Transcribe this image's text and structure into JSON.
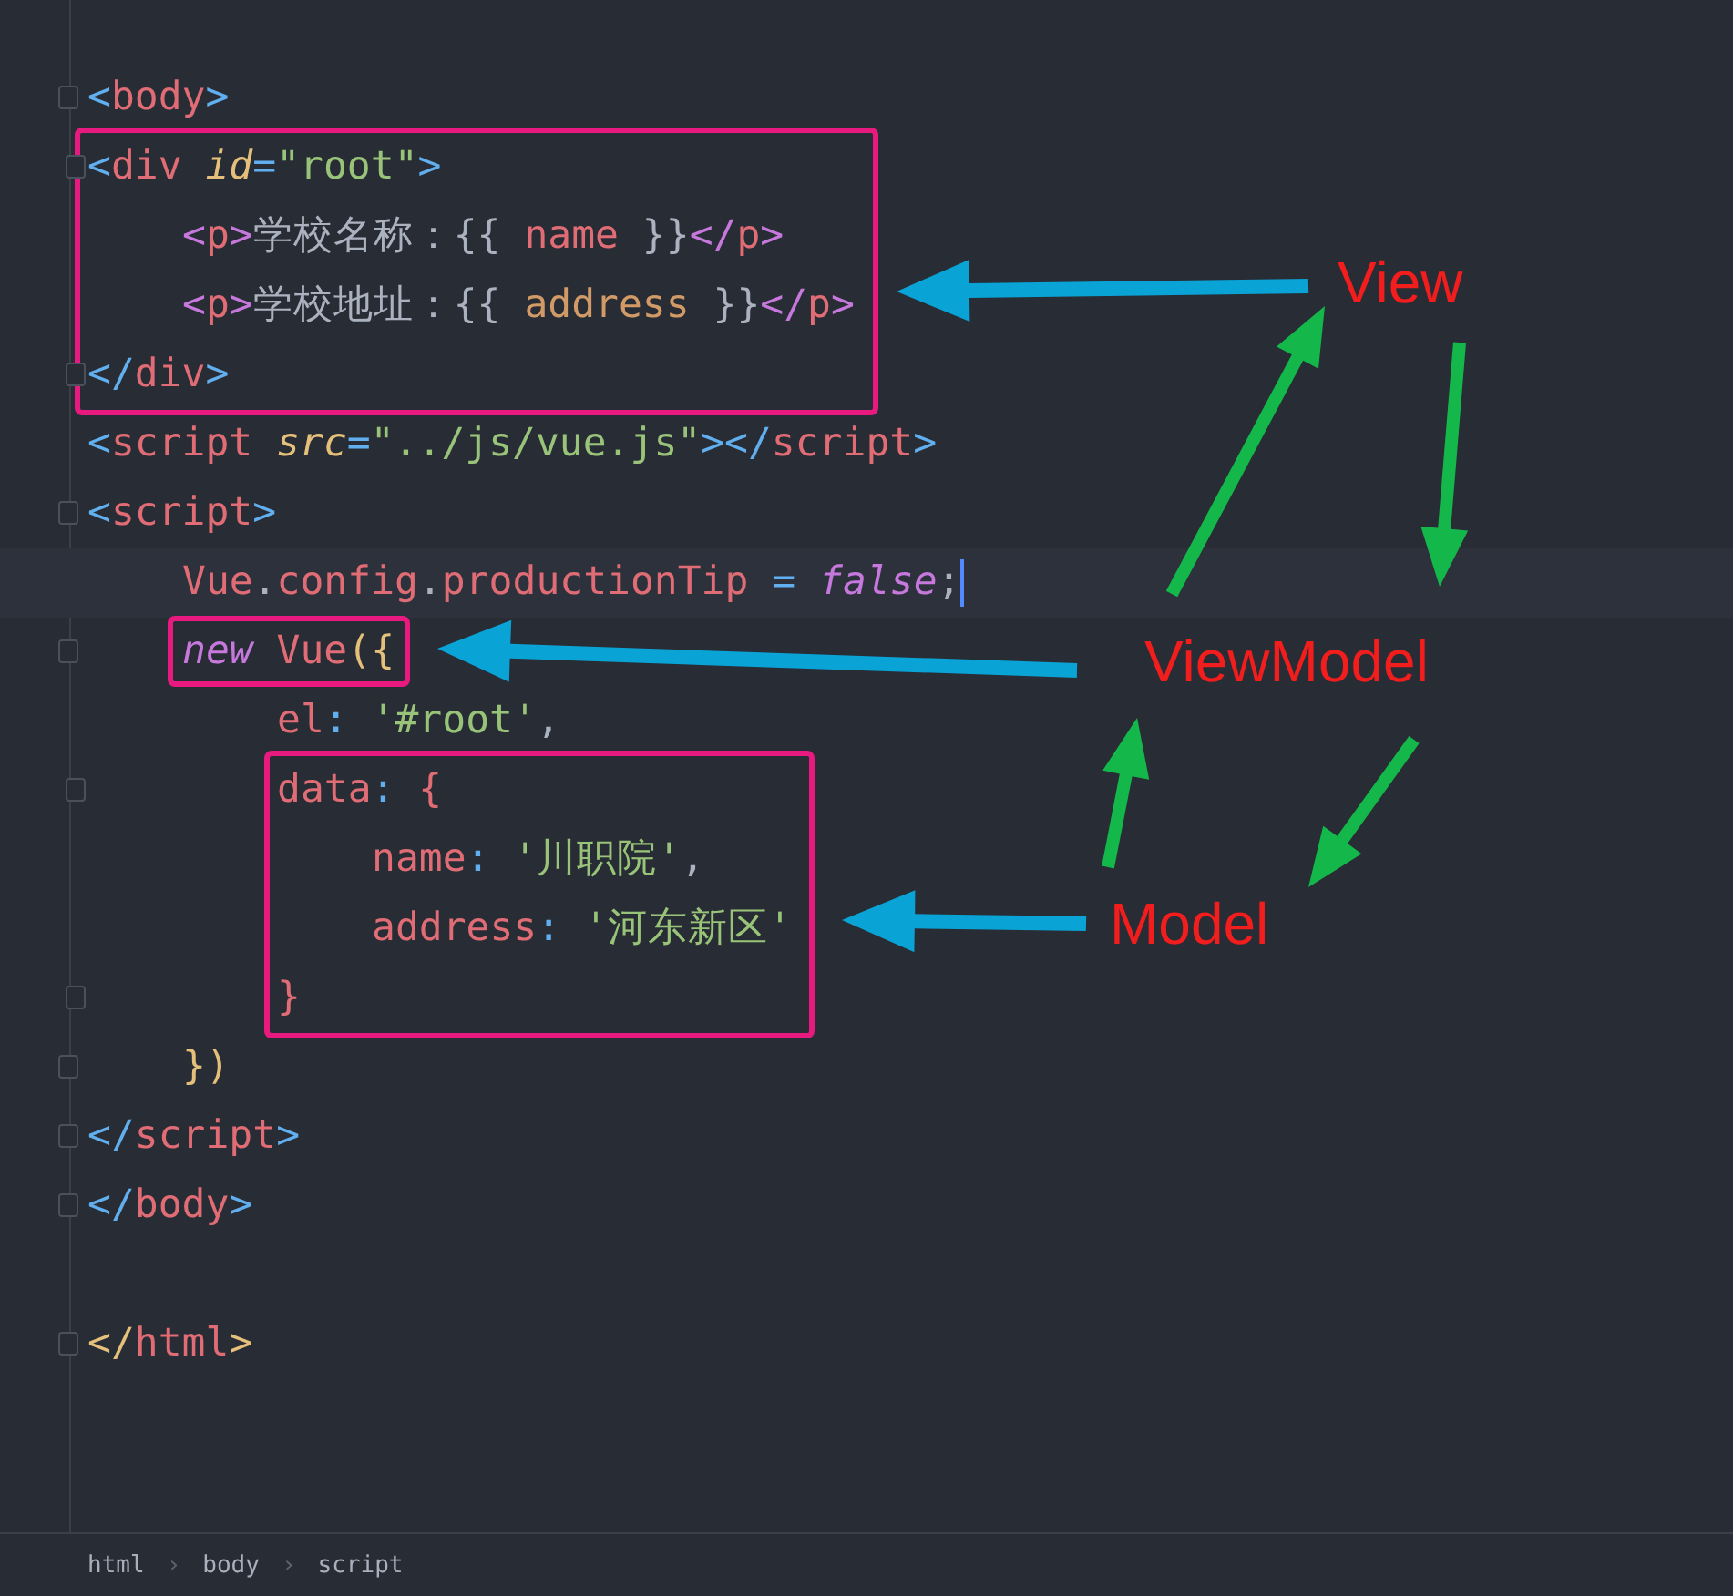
{
  "code": [
    {
      "fold": true,
      "tokens": [
        {
          "kind": "punct",
          "text": "<"
        },
        {
          "kind": "tag",
          "text": "body"
        },
        {
          "kind": "punct",
          "text": ">"
        }
      ]
    },
    {
      "fold": true,
      "framed": true,
      "tokens": [
        {
          "kind": "punct",
          "text": "<"
        },
        {
          "kind": "tag",
          "text": "div"
        },
        {
          "kind": "attr",
          "text": " id"
        },
        {
          "kind": "op",
          "text": "="
        },
        {
          "kind": "str",
          "text": "\"root\""
        },
        {
          "kind": "punct",
          "text": ">"
        }
      ],
      "children": [
        {
          "tokens": [
            {
              "kind": "ptag",
              "text": "<"
            },
            {
              "kind": "tag",
              "text": "p"
            },
            {
              "kind": "ptag",
              "text": ">"
            },
            {
              "kind": "text",
              "text": "学校名称：{{ "
            },
            {
              "kind": "ident",
              "text": "name"
            },
            {
              "kind": "text",
              "text": " }}"
            },
            {
              "kind": "ptag",
              "text": "</"
            },
            {
              "kind": "tag",
              "text": "p"
            },
            {
              "kind": "ptag",
              "text": ">"
            }
          ]
        },
        {
          "tokens": [
            {
              "kind": "ptag",
              "text": "<"
            },
            {
              "kind": "tag",
              "text": "p"
            },
            {
              "kind": "ptag",
              "text": ">"
            },
            {
              "kind": "text",
              "text": "学校地址：{{ "
            },
            {
              "kind": "ident2",
              "text": "address"
            },
            {
              "kind": "text",
              "text": " }}"
            },
            {
              "kind": "ptag",
              "text": "</"
            },
            {
              "kind": "tag",
              "text": "p"
            },
            {
              "kind": "ptag",
              "text": ">"
            }
          ]
        }
      ],
      "close": {
        "fold": true,
        "tokens": [
          {
            "kind": "punct",
            "text": "</"
          },
          {
            "kind": "tag",
            "text": "div"
          },
          {
            "kind": "punct",
            "text": ">"
          }
        ]
      }
    },
    {
      "tokens": [
        {
          "kind": "punct",
          "text": "<"
        },
        {
          "kind": "tag",
          "text": "script"
        },
        {
          "kind": "attr",
          "text": " src"
        },
        {
          "kind": "op",
          "text": "="
        },
        {
          "kind": "str",
          "text": "\"../js/vue.js\""
        },
        {
          "kind": "punct",
          "text": "></"
        },
        {
          "kind": "tag",
          "text": "script"
        },
        {
          "kind": "punct",
          "text": ">"
        }
      ]
    },
    {
      "fold": true,
      "tokens": [
        {
          "kind": "punct",
          "text": "<"
        },
        {
          "kind": "tag",
          "text": "script"
        },
        {
          "kind": "punct",
          "text": ">"
        }
      ],
      "children": [
        {
          "current": true,
          "tokens": [
            {
              "kind": "ident",
              "text": "Vue"
            },
            {
              "kind": "plain",
              "text": "."
            },
            {
              "kind": "ident",
              "text": "config"
            },
            {
              "kind": "plain",
              "text": "."
            },
            {
              "kind": "ident",
              "text": "productionTip"
            },
            {
              "kind": "op",
              "text": " = "
            },
            {
              "kind": "kw",
              "text": "false"
            },
            {
              "kind": "plain",
              "text": ";"
            }
          ]
        },
        {
          "fold": true,
          "line_framed": true,
          "tokens": [
            {
              "kind": "kw",
              "text": "new"
            },
            {
              "kind": "ident",
              "text": " Vue"
            },
            {
              "kind": "brace",
              "text": "({"
            }
          ],
          "children": [
            {
              "tokens": [
                {
                  "kind": "ident",
                  "text": "el"
                },
                {
                  "kind": "op",
                  "text": ":"
                },
                {
                  "kind": "str",
                  "text": " '#root'"
                },
                {
                  "kind": "plain",
                  "text": ","
                }
              ]
            },
            {
              "fold": true,
              "framed": true,
              "tokens": [
                {
                  "kind": "ident",
                  "text": "data"
                },
                {
                  "kind": "op",
                  "text": ":"
                },
                {
                  "kind": "ident",
                  "text": " {"
                }
              ],
              "children": [
                {
                  "tokens": [
                    {
                      "kind": "ident",
                      "text": "name"
                    },
                    {
                      "kind": "op",
                      "text": ":"
                    },
                    {
                      "kind": "str",
                      "text": " '川职院'"
                    },
                    {
                      "kind": "plain",
                      "text": ","
                    }
                  ]
                },
                {
                  "tokens": [
                    {
                      "kind": "ident",
                      "text": "address"
                    },
                    {
                      "kind": "op",
                      "text": ":"
                    },
                    {
                      "kind": "str",
                      "text": " '河东新区'"
                    }
                  ]
                }
              ],
              "close": {
                "fold": true,
                "tokens": [
                  {
                    "kind": "ident",
                    "text": "}"
                  }
                ]
              }
            }
          ],
          "close": {
            "fold": true,
            "tokens": [
              {
                "kind": "brace",
                "text": "})"
              }
            ]
          }
        }
      ],
      "close": {
        "fold": true,
        "tokens": [
          {
            "kind": "punct",
            "text": "</"
          },
          {
            "kind": "tag",
            "text": "script"
          },
          {
            "kind": "punct",
            "text": ">"
          }
        ]
      }
    },
    {
      "fold": true,
      "tokens": [
        {
          "kind": "punct",
          "text": "</"
        },
        {
          "kind": "tag",
          "text": "body"
        },
        {
          "kind": "punct",
          "text": ">"
        }
      ]
    },
    {
      "kind": "blank"
    },
    {
      "fold": true,
      "tokens": [
        {
          "kind": "brace",
          "text": "</"
        },
        {
          "kind": "tag",
          "text": "html"
        },
        {
          "kind": "brace",
          "text": ">"
        }
      ]
    }
  ],
  "annotations": {
    "labels": [
      {
        "text": "View"
      },
      {
        "text": "ViewModel"
      },
      {
        "text": "Model"
      }
    ]
  },
  "breadcrumb": [
    {
      "kind": "item",
      "text": "html"
    },
    {
      "kind": "sep",
      "text": "›"
    },
    {
      "kind": "item",
      "text": "body"
    },
    {
      "kind": "sep",
      "text": "›"
    },
    {
      "kind": "item",
      "text": "script"
    }
  ]
}
